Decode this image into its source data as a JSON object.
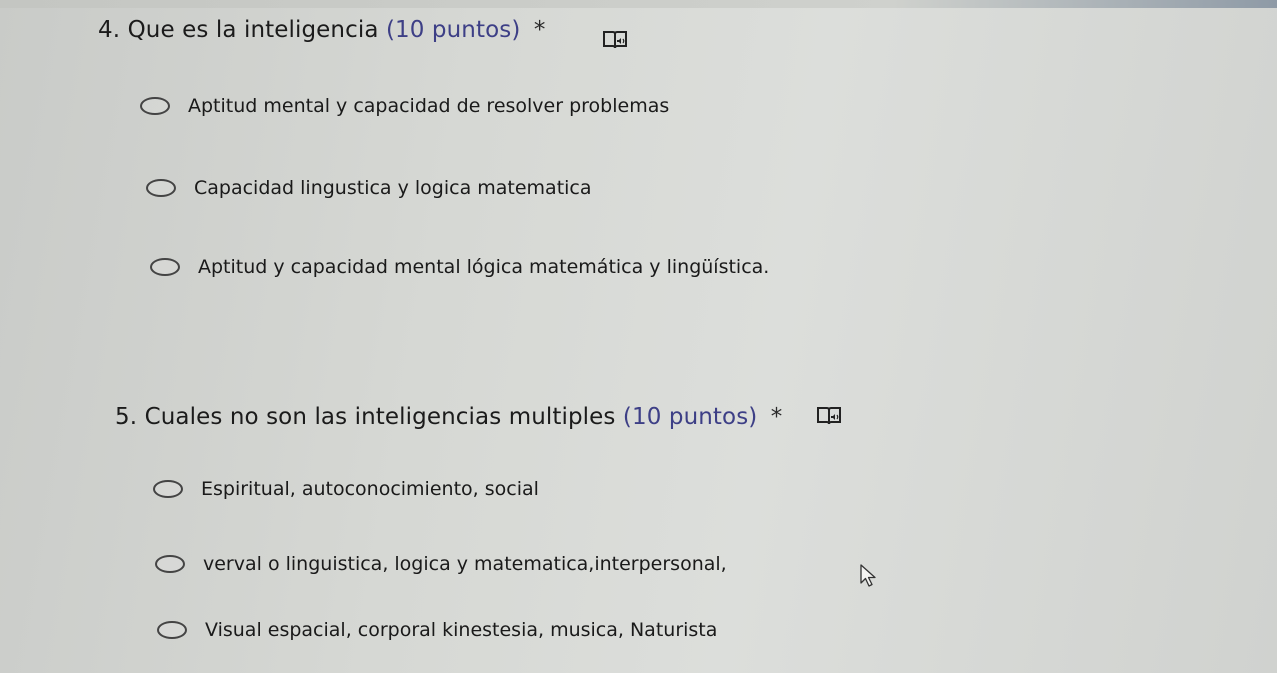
{
  "questions": [
    {
      "number": "4.",
      "text": "Que es la inteligencia",
      "points": "(10 puntos)",
      "required_mark": "*",
      "reader_icon": "immersive-reader-icon",
      "options": [
        "Aptitud mental y capacidad de resolver problemas",
        "Capacidad lingustica y logica matematica",
        "Aptitud y capacidad mental lógica matemática y lingüística."
      ]
    },
    {
      "number": "5.",
      "text": "Cuales no son las inteligencias multiples",
      "points": "(10 puntos)",
      "required_mark": "*",
      "reader_icon": "immersive-reader-icon",
      "options": [
        "Espiritual, autoconocimiento, social",
        "verval o linguistica, logica y matematica,interpersonal,",
        "Visual espacial, corporal kinestesia, musica, Naturista"
      ]
    }
  ],
  "cursor": "pointer-cursor-icon"
}
